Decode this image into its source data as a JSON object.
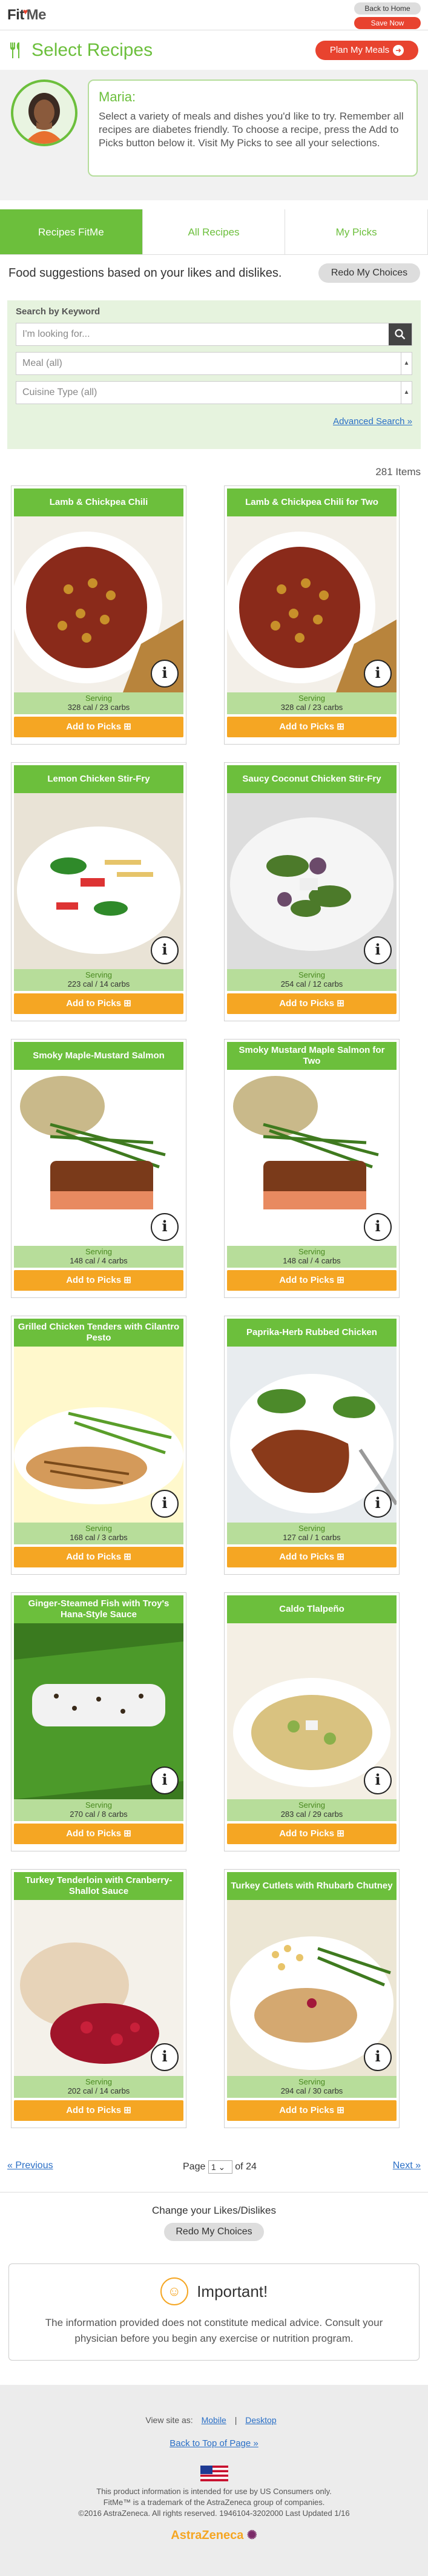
{
  "topbar": {
    "logo_left": "Fit",
    "logo_right": "Me",
    "back_home": "Back to Home",
    "save_now": "Save Now"
  },
  "header": {
    "title": "Select Recipes",
    "plan_button": "Plan My Meals"
  },
  "intro": {
    "name": "Maria:",
    "message": "Select a variety of meals and dishes you'd like to try. Remember all recipes are diabetes friendly. To choose a recipe, press the Add to Picks button below it. Visit My Picks to see all your selections."
  },
  "tabs": [
    {
      "label": "Recipes FitMe",
      "active": true
    },
    {
      "label": "All Recipes",
      "active": false
    },
    {
      "label": "My Picks",
      "active": false
    }
  ],
  "suggest": {
    "text": "Food suggestions based on your likes and dislikes.",
    "redo": "Redo My Choices"
  },
  "search": {
    "label": "Search by Keyword",
    "placeholder": "I'm looking for...",
    "meal": "Meal (all)",
    "cuisine": "Cuisine Type (all)",
    "advanced": "Advanced Search »"
  },
  "count": "281 Items",
  "serving_label": "Serving",
  "add_label": "Add to Picks ⊞",
  "recipes": [
    {
      "title": "Lamb & Chickpea Chili",
      "cal": "328 cal / 23 carbs",
      "img": "chili"
    },
    {
      "title": "Lamb & Chickpea Chili for Two",
      "cal": "328 cal / 23 carbs",
      "img": "chili"
    },
    {
      "title": "Lemon Chicken Stir-Fry",
      "cal": "223 cal / 14 carbs",
      "img": "stirfry"
    },
    {
      "title": "Saucy Coconut Chicken Stir-Fry",
      "cal": "254 cal / 12 carbs",
      "img": "coconut"
    },
    {
      "title": "Smoky Maple-Mustard Salmon",
      "cal": "148 cal / 4 carbs",
      "img": "salmon"
    },
    {
      "title": "Smoky Mustard Maple Salmon for Two",
      "cal": "148 cal / 4 carbs",
      "img": "salmon"
    },
    {
      "title": "Grilled Chicken Tenders with Cilantro Pesto",
      "cal": "168 cal / 3 carbs",
      "img": "tenders"
    },
    {
      "title": "Paprika-Herb Rubbed Chicken",
      "cal": "127 cal / 1 carbs",
      "img": "paprika"
    },
    {
      "title": "Ginger-Steamed Fish with Troy's Hana-Style Sauce",
      "cal": "270 cal / 8 carbs",
      "img": "fish"
    },
    {
      "title": "Caldo Tlalpeño",
      "cal": "283 cal / 29 carbs",
      "img": "soup"
    },
    {
      "title": "Turkey Tenderloin with Cranberry-Shallot Sauce",
      "cal": "202 cal / 14 carbs",
      "img": "turkey"
    },
    {
      "title": "Turkey Cutlets with Rhubarb Chutney",
      "cal": "294 cal / 30 carbs",
      "img": "cutlets"
    }
  ],
  "pager": {
    "prev": "« Previous",
    "page": "Page",
    "current": "1",
    "of": "of 24",
    "next": "Next »"
  },
  "change": {
    "text": "Change your Likes/Dislikes",
    "button": "Redo My Choices"
  },
  "important": {
    "heading": "Important!",
    "text": "The information provided does not constitute medical advice. Consult your physician before you begin any exercise or nutrition program."
  },
  "footer": {
    "view_as": "View site as:",
    "mobile": "Mobile",
    "sep": "|",
    "desktop": "Desktop",
    "back_top": "Back to Top of Page »",
    "legal1": "This product information is intended for use by US Consumers only.",
    "legal2": "FitMe™ is a trademark of the AstraZeneca group of companies.",
    "legal3": "©2016 AstraZeneca. All rights reserved. 1946104-3202000 Last Updated 1/16",
    "brand": "AstraZeneca"
  },
  "colors": {
    "green": "#6cbf3c",
    "orange": "#f5a623",
    "red": "#e8432f"
  }
}
